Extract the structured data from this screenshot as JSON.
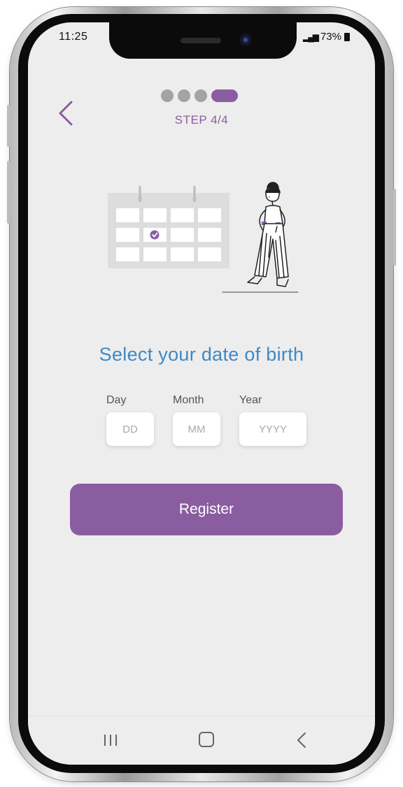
{
  "status_bar": {
    "time": "11:25",
    "battery": "73%"
  },
  "header": {
    "step_label": "STEP 4/4",
    "progress": {
      "total_steps": 4,
      "current_step": 4
    }
  },
  "main": {
    "title": "Select your date of birth",
    "fields": {
      "day": {
        "label": "Day",
        "placeholder": "DD",
        "value": ""
      },
      "month": {
        "label": "Month",
        "placeholder": "MM",
        "value": ""
      },
      "year": {
        "label": "Year",
        "placeholder": "YYYY",
        "value": ""
      }
    },
    "register_label": "Register"
  },
  "icons": {
    "back": "back-chevron-icon",
    "nav_recents": "recents-icon",
    "nav_home": "home-icon",
    "nav_back": "nav-back-icon",
    "calendar_check": "check-icon"
  },
  "colors": {
    "accent": "#8a5da0",
    "title": "#3f88c5",
    "screen_bg": "#ededed",
    "inactive_dot": "#a3a3a3"
  }
}
